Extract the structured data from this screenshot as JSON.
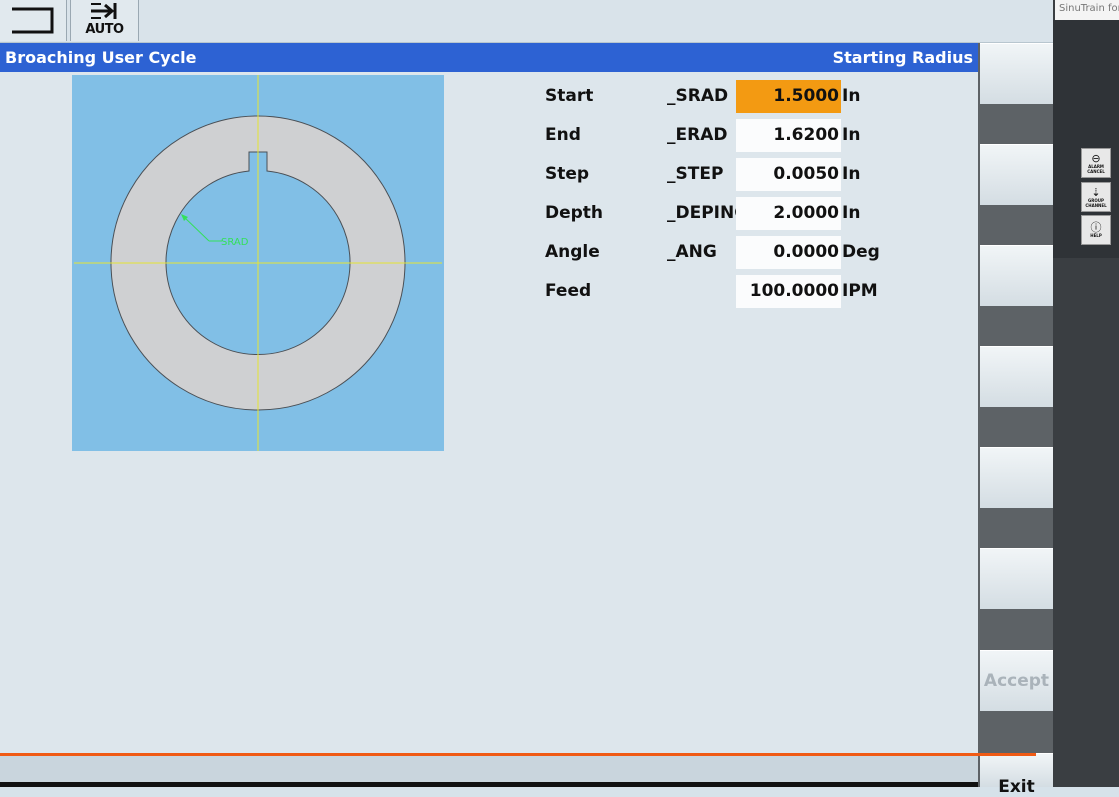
{
  "topbar": {
    "auto_label": "AUTO",
    "menu_icon": "menu-bracket-icon",
    "auto_icon": "arrow-into-bar-icon"
  },
  "header": {
    "cycle_title": "Broaching User Cycle",
    "param_title": "Starting Radius"
  },
  "params": [
    {
      "label": "Start",
      "var": "_SRAD",
      "value": "1.5000",
      "unit": "In",
      "active": true
    },
    {
      "label": "End",
      "var": "_ERAD",
      "value": "1.6200",
      "unit": "In",
      "active": false
    },
    {
      "label": "Step",
      "var": "_STEP",
      "value": "0.0050",
      "unit": "In",
      "active": false
    },
    {
      "label": "Depth",
      "var": "_DEPINC",
      "value": "2.0000",
      "unit": "In",
      "active": false
    },
    {
      "label": "Angle",
      "var": "_ANG",
      "value": "0.0000",
      "unit": "Deg",
      "active": false
    },
    {
      "label": "Feed",
      "var": "",
      "value": "100.0000",
      "unit": "IPM",
      "active": false
    }
  ],
  "graphic": {
    "annotation": "SRAD",
    "colors": {
      "background": "#81bfe6",
      "ring": "#cfd0d2",
      "axis": "#e6e432",
      "annotation": "#33e05a"
    }
  },
  "softkeys": {
    "accept_label": "Accept",
    "exit_label": "Exit"
  },
  "side_panel": {
    "app_name": "SinuTrain for",
    "alarm_cancel": "ALARM CANCEL",
    "group_channel": "GROUP CHANNEL",
    "help": "HELP"
  },
  "colors": {
    "title_bar": "#2d62d3",
    "active_field": "#f39a12",
    "progress_line": "#f05a14"
  }
}
